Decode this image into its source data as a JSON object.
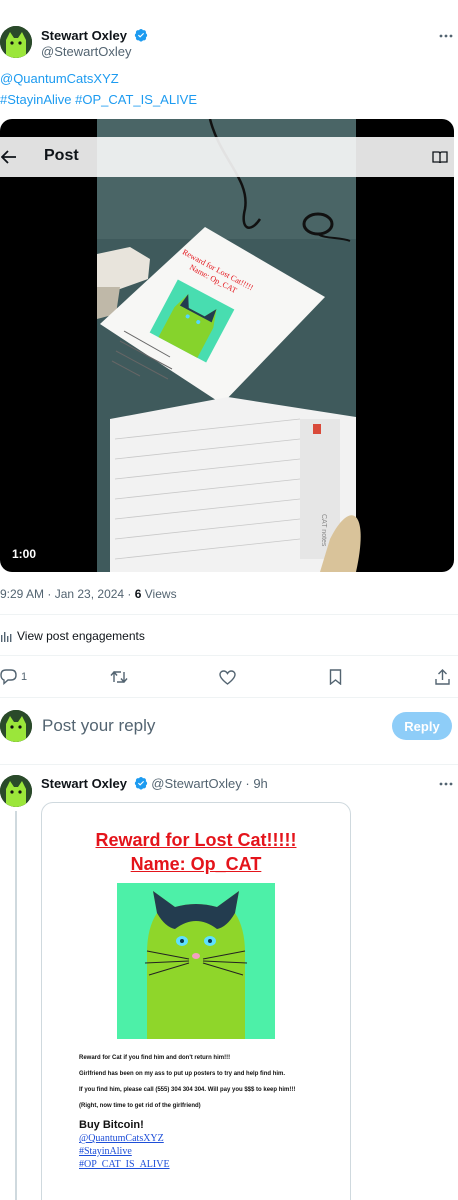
{
  "post": {
    "author_name": "Stewart Oxley",
    "author_handle": "@StewartOxley",
    "text_lines": [
      "@QuantumCatsXYZ",
      "#StayinAlive #OP_CAT_IS_ALIVE"
    ],
    "timestamp": "9:29 AM · Jan 23, 2024 · ",
    "views_count": "6",
    "views_label": " Views",
    "engagements_label": "View post engagements",
    "reply_count": "1"
  },
  "video": {
    "header_title": "Post",
    "duration": "1:00",
    "poster_title_line1": "Reward for Lost Cat!!!!!",
    "poster_title_line2": "Name: Op_CAT",
    "notepad_brand": "CAT notes"
  },
  "reply_box": {
    "placeholder": "Post your reply",
    "button_label": "Reply"
  },
  "reply": {
    "author_name": "Stewart Oxley",
    "author_handle": "@StewartOxley",
    "time": "· 9h",
    "poster_title_line1": "Reward for Lost Cat!!!!!",
    "poster_title_line2": "Name: Op_CAT",
    "lines": [
      "Reward for Cat if you find him and don't return him!!!",
      "Girlfriend has been on my ass to put up posters to try and help find him.",
      "If you find him, please call (555) 304 304 304. Will pay you $$$ to keep him!!!",
      "(Right, now time to get rid of the girlfriend)"
    ],
    "buy_label": "Buy Bitcoin!",
    "links": [
      "@QuantumCatsXYZ",
      "#StayinAlive",
      "#OP_CAT_IS_ALIVE"
    ]
  },
  "colors": {
    "accent": "#1d9bf0",
    "poster_red": "#e4141b",
    "cat_bg": "#4df0a8",
    "cat_body": "#8fd62a"
  },
  "icons": [
    "more-icon",
    "verified-icon",
    "back-icon",
    "reader-icon",
    "bar-chart-icon",
    "reply-icon",
    "retweet-icon",
    "like-icon",
    "bookmark-icon",
    "share-icon"
  ]
}
